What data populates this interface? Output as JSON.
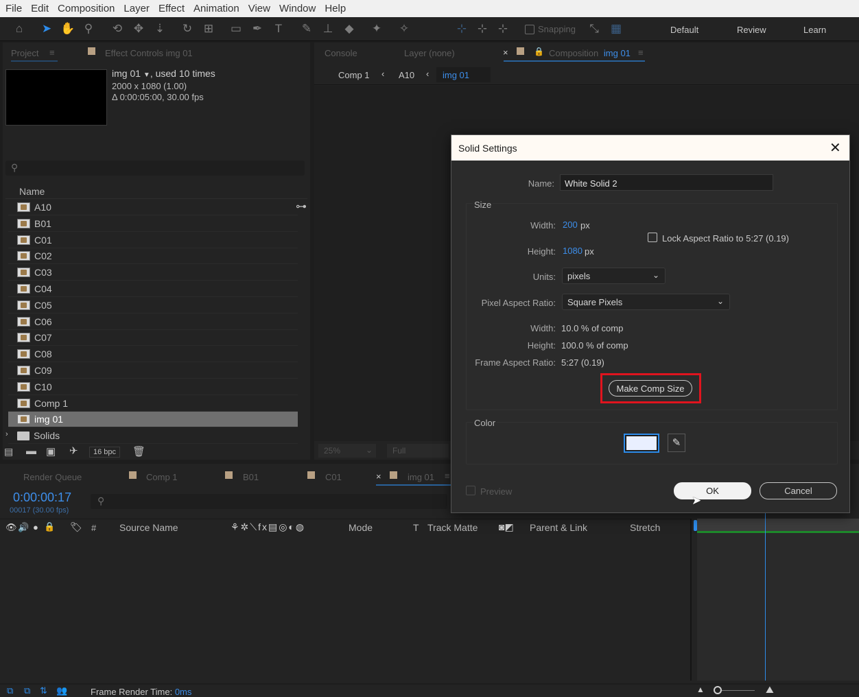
{
  "menu": [
    "File",
    "Edit",
    "Composition",
    "Layer",
    "Effect",
    "Animation",
    "View",
    "Window",
    "Help"
  ],
  "toolbar": {
    "snapping_label": "Snapping",
    "workspaces": [
      "Default",
      "Review",
      "Learn"
    ]
  },
  "project_panel": {
    "tab_project": "Project",
    "tab_effect_controls": "Effect Controls img 01",
    "item_name": "img 01",
    "item_used": ", used 10 times",
    "item_dims": "2000 x 1080 (1.00)",
    "item_duration": "Δ 0:00:05:00, 30.00 fps",
    "column_name": "Name",
    "items": [
      {
        "label": "A10",
        "kind": "comp"
      },
      {
        "label": "B01",
        "kind": "comp"
      },
      {
        "label": "C01",
        "kind": "comp"
      },
      {
        "label": "C02",
        "kind": "comp"
      },
      {
        "label": "C03",
        "kind": "comp"
      },
      {
        "label": "C04",
        "kind": "comp"
      },
      {
        "label": "C05",
        "kind": "comp"
      },
      {
        "label": "C06",
        "kind": "comp"
      },
      {
        "label": "C07",
        "kind": "comp"
      },
      {
        "label": "C08",
        "kind": "comp"
      },
      {
        "label": "C09",
        "kind": "comp"
      },
      {
        "label": "C10",
        "kind": "comp"
      },
      {
        "label": "Comp 1",
        "kind": "comp"
      },
      {
        "label": "img 01",
        "kind": "comp",
        "selected": true
      },
      {
        "label": "Solids",
        "kind": "folder"
      }
    ],
    "bpc": "16 bpc"
  },
  "comp_panel": {
    "tab_console": "Console",
    "tab_layer": "Layer (none)",
    "tab_composition_prefix": "Composition",
    "tab_composition_name": "img 01",
    "breadcrumbs": [
      "Comp 1",
      "A10",
      "img 01"
    ],
    "zoom": "25%",
    "resolution": "Full"
  },
  "timeline": {
    "tabs": [
      "Render Queue",
      "Comp 1",
      "B01",
      "C01",
      "img 01"
    ],
    "timecode": "0:00:00:17",
    "frame_info": "00017 (30.00 fps)",
    "columns": {
      "hash": "#",
      "source_name": "Source Name",
      "mode": "Mode",
      "t": "T",
      "track_matte": "Track Matte",
      "parent_link": "Parent & Link",
      "stretch": "Stretch"
    },
    "status_label": "Frame Render Time:",
    "status_value": "0ms"
  },
  "dialog": {
    "title": "Solid Settings",
    "name_label": "Name:",
    "name_value": "White Solid 2",
    "size_group": "Size",
    "width_label": "Width:",
    "width_value": "200",
    "height_label": "Height:",
    "height_value": "1080",
    "px_unit": "px",
    "lock_aspect_label": "Lock Aspect Ratio to 5:27 (0.19)",
    "units_label": "Units:",
    "units_value": "pixels",
    "par_label": "Pixel Aspect Ratio:",
    "par_value": "Square Pixels",
    "pct_width_label": "Width:",
    "pct_width_value": "10.0 % of comp",
    "pct_height_label": "Height:",
    "pct_height_value": "100.0 % of comp",
    "far_label": "Frame Aspect Ratio:",
    "far_value": "5:27 (0.19)",
    "make_comp_size": "Make Comp Size",
    "color_group": "Color",
    "color_swatch": "#e9efff",
    "preview_label": "Preview",
    "ok_label": "OK",
    "cancel_label": "Cancel"
  },
  "colors": {
    "accent_blue": "#2d8ceb",
    "highlight_red": "#e0141e",
    "swatch_tan": "#b8a083"
  }
}
